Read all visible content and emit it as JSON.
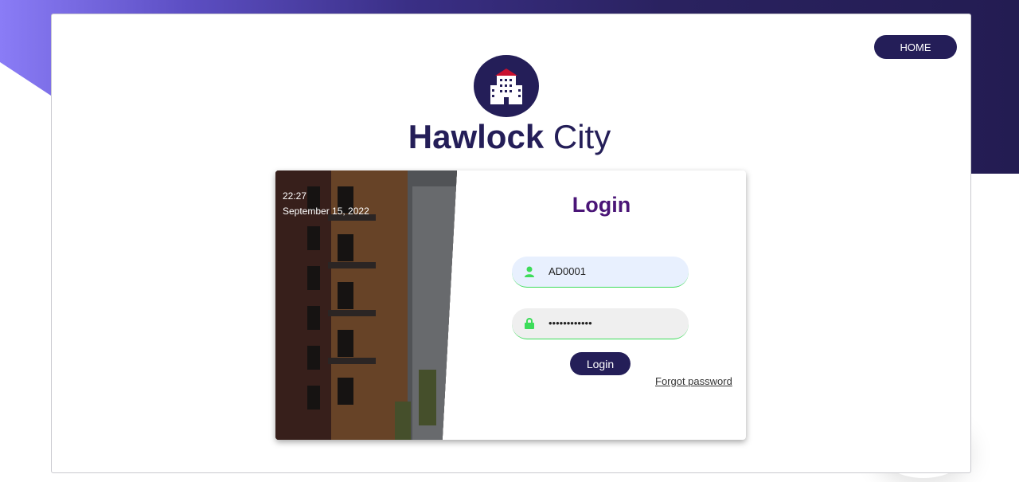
{
  "nav": {
    "home_label": "HOME"
  },
  "brand": {
    "name_bold": "Hawlock",
    "name_light": "City",
    "logo_icon": "building-icon"
  },
  "sidebar_photo": {
    "time": "22:27",
    "date": "September 15, 2022"
  },
  "form": {
    "title": "Login",
    "username_value": "AD0001",
    "username_icon": "user-icon",
    "password_value": "••••••••••••",
    "password_icon": "lock-icon",
    "submit_label": "Login",
    "forgot_label": "Forgot password"
  },
  "colors": {
    "primary": "#241e58",
    "title": "#4a1577",
    "accent_green": "#3ddc5a"
  }
}
